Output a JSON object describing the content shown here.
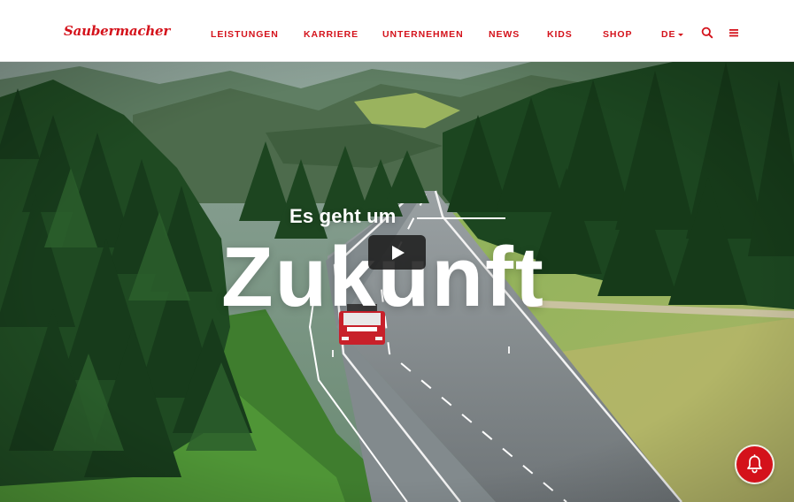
{
  "brand": {
    "logo_text": "Saubermacher",
    "accent_color": "#d4121b"
  },
  "nav": {
    "items": [
      {
        "label": "LEISTUNGEN"
      },
      {
        "label": "KARRIERE"
      },
      {
        "label": "UNTERNEHMEN"
      },
      {
        "label": "NEWS"
      },
      {
        "label": "KIDS"
      },
      {
        "label": "SHOP"
      }
    ],
    "language": "DE",
    "icons": [
      "search-icon",
      "menu-icon"
    ]
  },
  "hero": {
    "tagline": "Es geht um",
    "headline": "Zukunft",
    "play_icon": "play-icon"
  },
  "notification": {
    "icon": "bell-icon"
  }
}
